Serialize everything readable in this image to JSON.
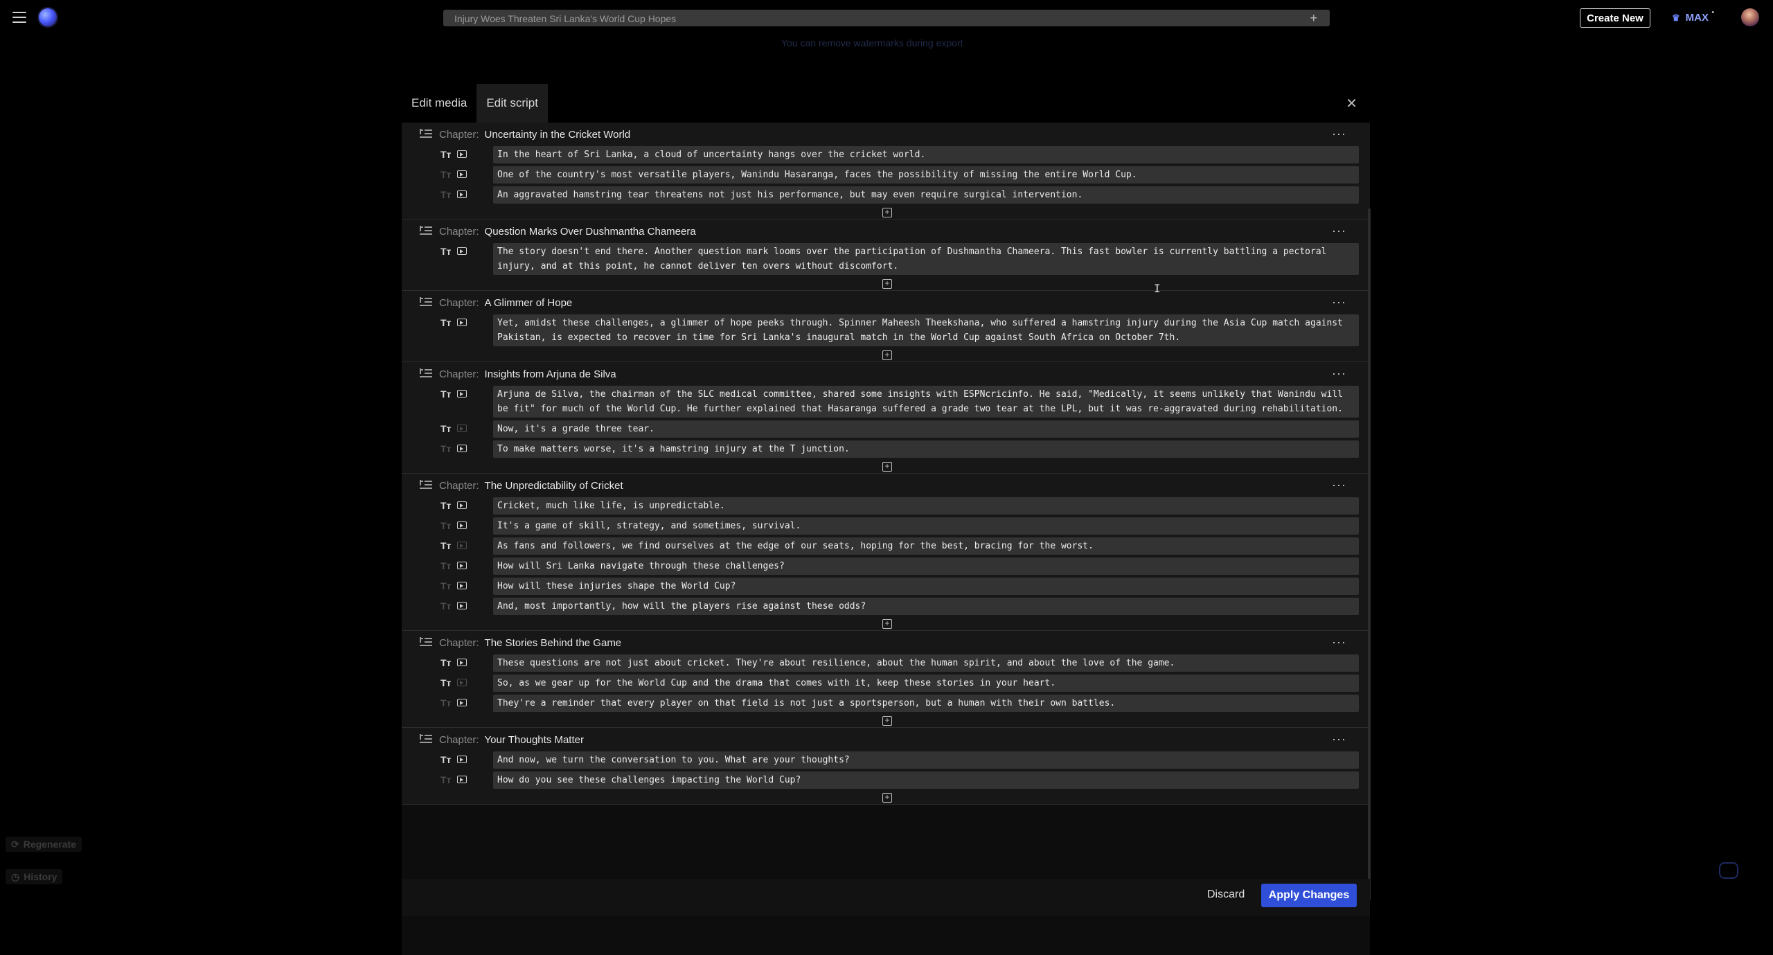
{
  "header": {
    "project_title": "Injury Woes Threaten Sri Lanka's World Cup Hopes",
    "watermark_note": "You can remove watermarks during export",
    "create_new": "Create New",
    "plan": "MAX",
    "plus_icon": "plus-icon"
  },
  "sidebar": {
    "regenerate": "Regenerate",
    "history": "History"
  },
  "modal": {
    "tabs": [
      "Edit media",
      "Edit script"
    ],
    "active_tab": "Edit script",
    "chapter_label": "Chapter:",
    "chapters": [
      {
        "title": "Uncertainty in the Cricket World",
        "lines": [
          {
            "text": "In the heart of Sri Lanka, a cloud of uncertainty hangs over the cricket world.",
            "t_active": true,
            "m_active": true
          },
          {
            "text": "One of the country's most versatile players, Wanindu Hasaranga, faces the possibility of missing the entire World Cup.",
            "t_active": false,
            "m_active": true
          },
          {
            "text": "An aggravated hamstring tear threatens not just his performance, but may even require surgical intervention.",
            "t_active": false,
            "m_active": true
          }
        ]
      },
      {
        "title": "Question Marks Over Dushmantha Chameera",
        "lines": [
          {
            "text": "The story doesn't end there. Another question mark looms over the participation of Dushmantha Chameera. This fast bowler is currently battling a pectoral injury, and at this point, he cannot deliver ten overs without discomfort.",
            "t_active": true,
            "m_active": true
          }
        ]
      },
      {
        "title": "A Glimmer of Hope",
        "lines": [
          {
            "text": "Yet, amidst these challenges, a glimmer of hope peeks through. Spinner Maheesh Theekshana, who suffered a hamstring injury during the Asia Cup match against Pakistan, is expected to recover in time for Sri Lanka's inaugural match in the World Cup against South Africa on October 7th.",
            "t_active": true,
            "m_active": true
          }
        ]
      },
      {
        "title": "Insights from Arjuna de Silva",
        "lines": [
          {
            "text": "Arjuna de Silva, the chairman of the SLC medical committee, shared some insights with ESPNcricinfo. He said, \"Medically, it seems unlikely that Wanindu will be fit\" for much of the World Cup. He further explained that Hasaranga suffered a grade two tear at the LPL, but it was re-aggravated during rehabilitation.",
            "t_active": true,
            "m_active": true
          },
          {
            "text": "Now, it's a grade three tear.",
            "t_active": true,
            "m_active": false
          },
          {
            "text": "To make matters worse, it's a hamstring injury at the T junction.",
            "t_active": false,
            "m_active": true
          }
        ]
      },
      {
        "title": "The Unpredictability of Cricket",
        "lines": [
          {
            "text": "Cricket, much like life, is unpredictable.",
            "t_active": true,
            "m_active": true
          },
          {
            "text": "It's a game of skill, strategy, and sometimes, survival.",
            "t_active": false,
            "m_active": true
          },
          {
            "text": "As fans and followers, we find ourselves at the edge of our seats, hoping for the best, bracing for the worst.",
            "t_active": true,
            "m_active": false
          },
          {
            "text": "How will Sri Lanka navigate through these challenges?",
            "t_active": false,
            "m_active": true
          },
          {
            "text": "How will these injuries shape the World Cup?",
            "t_active": false,
            "m_active": true
          },
          {
            "text": "And, most importantly, how will the players rise against these odds?",
            "t_active": false,
            "m_active": true
          }
        ]
      },
      {
        "title": "The Stories Behind the Game",
        "lines": [
          {
            "text": "These questions are not just about cricket. They're about resilience, about the human spirit, and about the love of the game.",
            "t_active": true,
            "m_active": true
          },
          {
            "text": "So, as we gear up for the World Cup and the drama that comes with it, keep these stories in your heart.",
            "t_active": true,
            "m_active": false
          },
          {
            "text": "They're a reminder that every player on that field is not just a sportsperson, but a human with their own battles.",
            "t_active": false,
            "m_active": true
          }
        ]
      },
      {
        "title": "Your Thoughts Matter",
        "lines": [
          {
            "text": "And now, we turn the conversation to you. What are your thoughts?",
            "t_active": true,
            "m_active": true
          },
          {
            "text": "How do you see these challenges impacting the World Cup?",
            "t_active": false,
            "m_active": true
          }
        ]
      }
    ],
    "discard": "Discard",
    "apply": "Apply Changes"
  },
  "colors": {
    "accent": "#2f4fd8",
    "plan": "#8fa3ff"
  }
}
